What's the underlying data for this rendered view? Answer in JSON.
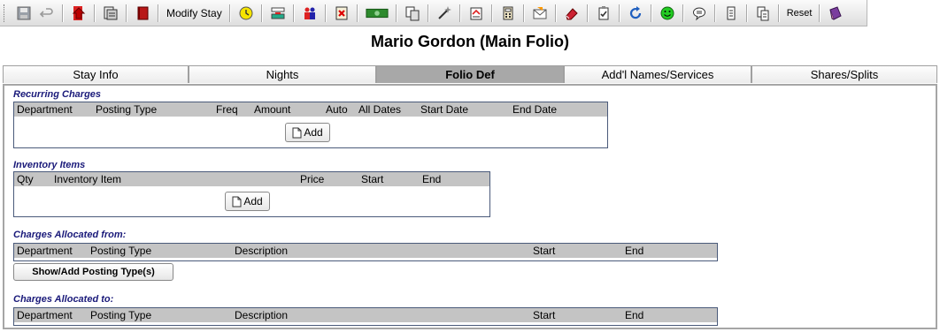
{
  "toolbar": {
    "modify_stay_label": "Modify Stay",
    "reset_label": "Reset",
    "icons": [
      "save-icon",
      "undo-icon",
      "checkout-icon",
      "print-icon",
      "book-icon",
      "modify-stay-label",
      "clock-icon",
      "rate-icon",
      "guests-icon",
      "cancel-icon",
      "money-icon",
      "copy-icon",
      "wand-icon",
      "bill-icon",
      "calculator-icon",
      "mail-icon",
      "eraser-icon",
      "clipboard-check-icon",
      "refresh-icon",
      "smiley-icon",
      "speech-bubble-icon",
      "scroll-icon",
      "documents-icon",
      "reset-label",
      "spellbook-icon"
    ]
  },
  "title": "Mario Gordon (Main Folio)",
  "tabs": [
    {
      "label": "Stay Info"
    },
    {
      "label": "Nights"
    },
    {
      "label": "Folio Def"
    },
    {
      "label": "Add'l Names/Services"
    },
    {
      "label": "Shares/Splits"
    }
  ],
  "recurring": {
    "label": "Recurring Charges",
    "columns": [
      "Department",
      "Posting Type",
      "Freq",
      "Amount",
      "Auto",
      "All Dates",
      "Start Date",
      "End Date"
    ],
    "add_label": "Add"
  },
  "inventory": {
    "label": "Inventory Items",
    "columns": [
      "Qty",
      "Inventory Item",
      "Price",
      "Start",
      "End"
    ],
    "add_label": "Add"
  },
  "alloc_from": {
    "label": "Charges Allocated from:",
    "columns": [
      "Department",
      "Posting Type",
      "Description",
      "Start",
      "End"
    ],
    "button_label": "Show/Add Posting Type(s)"
  },
  "alloc_to": {
    "label": "Charges Allocated to:",
    "columns": [
      "Department",
      "Posting Type",
      "Description",
      "Start",
      "End"
    ]
  },
  "colors": {
    "section_label": "#1a1a7a",
    "active_tab": "#a8a8a8",
    "grid_header": "#c4c4c4",
    "grid_border": "#4a5a7a"
  }
}
